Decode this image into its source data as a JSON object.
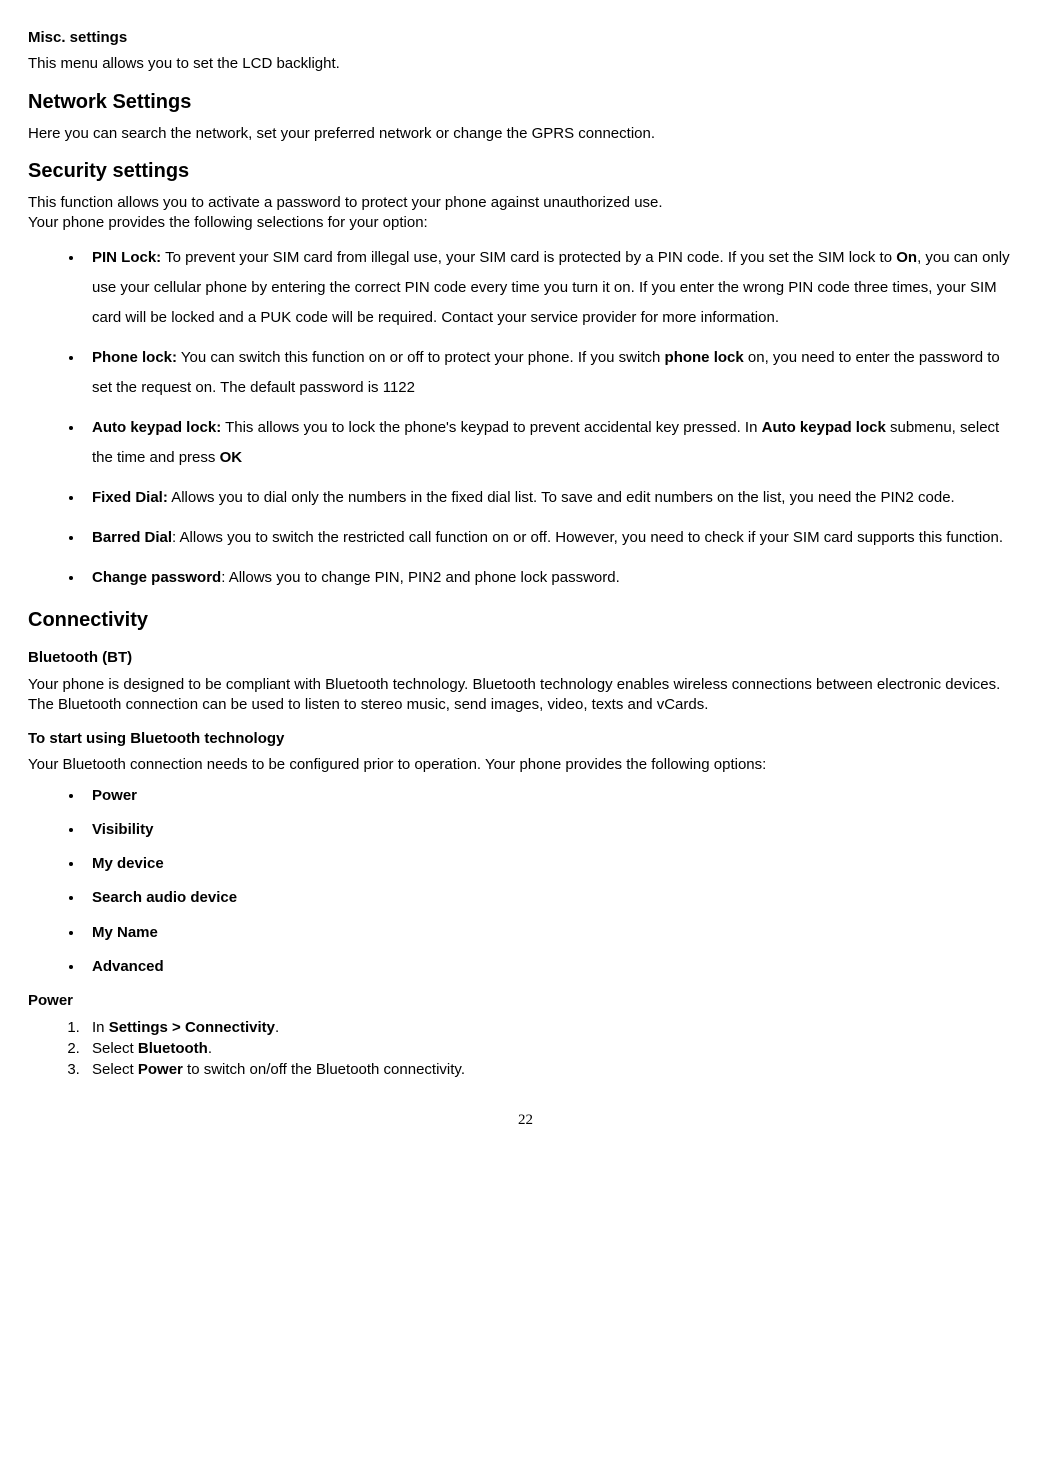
{
  "misc": {
    "heading": "Misc. settings",
    "body": "This menu allows you to set the LCD backlight."
  },
  "network": {
    "heading": "Network Settings",
    "body": "Here you can search the network, set your preferred network or change the GPRS connection."
  },
  "security": {
    "heading": "Security settings",
    "intro1": "This function allows you to activate a password to protect your phone against unauthorized use.",
    "intro2": "Your phone provides the following selections for your option:",
    "pin_label": "PIN Lock:",
    "pin_t1": " To prevent your SIM card from illegal use, your SIM card is protected by a PIN code. If you set the SIM lock to ",
    "pin_on": "On",
    "pin_t2": ", you can only use your cellular phone by entering the correct PIN code every time you turn it on. If you enter the wrong PIN code three times, your SIM card will be locked and a PUK code will be required. Contact your service provider for more information.",
    "phone_label": "Phone lock:",
    "phone_t1": " You can switch this function on or off to protect your phone.   If you switch ",
    "phone_b": "phone lock",
    "phone_t2": " on, you need to enter the password to set the request on. The default password is 1122",
    "auto_label": "Auto keypad lock:",
    "auto_t1": " This allows you to lock the phone's keypad to prevent accidental key pressed. In ",
    "auto_b": "Auto keypad lock",
    "auto_t2": " submenu, select the time and press ",
    "auto_ok": "OK",
    "fixed_label": "Fixed Dial:",
    "fixed_t": " Allows you to dial only the numbers in the fixed dial list. To save and edit numbers on the list, you need the PIN2 code.",
    "barred_label": "Barred Dial",
    "barred_t": ": Allows you to switch the restricted call function on or off. However, you need to check if your SIM card supports this function.",
    "change_label": "Change password",
    "change_t": ": Allows you to change PIN, PIN2 and phone lock password."
  },
  "conn": {
    "heading": "Connectivity",
    "bt_heading": "Bluetooth (BT)",
    "bt_body": "Your phone is designed to be compliant with Bluetooth technology. Bluetooth technology enables wireless connections between electronic devices. The Bluetooth connection can be used to listen to stereo music, send images, video, texts and vCards.",
    "start_heading": "To start using Bluetooth technology",
    "start_body": "Your Bluetooth connection needs to be configured prior to operation. Your phone provides the following options:",
    "opts": [
      "Power",
      "Visibility",
      "My device",
      "Search audio device",
      "My Name",
      "Advanced"
    ],
    "power_heading": "Power",
    "step1_a": "In ",
    "step1_b": "Settings > Connectivity",
    "step1_c": ".",
    "step2_a": "Select ",
    "step2_b": "Bluetooth",
    "step2_c": ".",
    "step3_a": "Select ",
    "step3_b": "Power",
    "step3_c": " to switch on/off the Bluetooth connectivity."
  },
  "page": "22"
}
